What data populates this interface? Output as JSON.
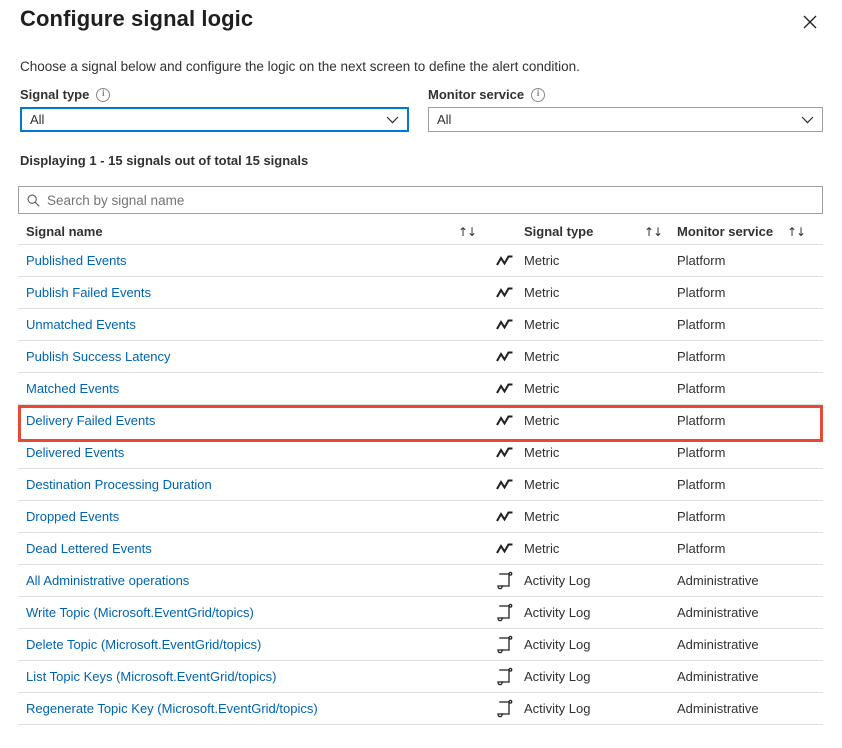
{
  "header": {
    "title": "Configure signal logic",
    "close_icon": "close-icon"
  },
  "description": "Choose a signal below and configure the logic on the next screen to define the alert condition.",
  "filters": {
    "signal_type": {
      "label": "Signal type",
      "info_icon": "info-icon",
      "value": "All",
      "chevron_icon": "chevron-down-icon",
      "focused": true
    },
    "monitor_service": {
      "label": "Monitor service",
      "info_icon": "info-icon",
      "value": "All",
      "chevron_icon": "chevron-down-icon",
      "focused": false
    }
  },
  "displaying": "Displaying 1 - 15 signals out of total 15 signals",
  "search": {
    "placeholder": "Search by signal name",
    "value": "",
    "icon": "search-icon"
  },
  "table": {
    "columns": [
      {
        "label": "Signal name",
        "sort_icon": "sort-ascending-descending-icon"
      },
      {
        "label": "Signal type",
        "sort_icon": "sort-ascending-descending-icon"
      },
      {
        "label": "Monitor service",
        "sort_icon": "sort-ascending-descending-icon"
      }
    ],
    "sort_glyph": "↑↓",
    "rows": [
      {
        "name": "Published Events",
        "type": "Metric",
        "type_icon": "metric-line-chart-icon",
        "service": "Platform",
        "highlighted": false
      },
      {
        "name": "Publish Failed Events",
        "type": "Metric",
        "type_icon": "metric-line-chart-icon",
        "service": "Platform",
        "highlighted": false
      },
      {
        "name": "Unmatched Events",
        "type": "Metric",
        "type_icon": "metric-line-chart-icon",
        "service": "Platform",
        "highlighted": false
      },
      {
        "name": "Publish Success Latency",
        "type": "Metric",
        "type_icon": "metric-line-chart-icon",
        "service": "Platform",
        "highlighted": false
      },
      {
        "name": "Matched Events",
        "type": "Metric",
        "type_icon": "metric-line-chart-icon",
        "service": "Platform",
        "highlighted": false
      },
      {
        "name": "Delivery Failed Events",
        "type": "Metric",
        "type_icon": "metric-line-chart-icon",
        "service": "Platform",
        "highlighted": true
      },
      {
        "name": "Delivered Events",
        "type": "Metric",
        "type_icon": "metric-line-chart-icon",
        "service": "Platform",
        "highlighted": false
      },
      {
        "name": "Destination Processing Duration",
        "type": "Metric",
        "type_icon": "metric-line-chart-icon",
        "service": "Platform",
        "highlighted": false
      },
      {
        "name": "Dropped Events",
        "type": "Metric",
        "type_icon": "metric-line-chart-icon",
        "service": "Platform",
        "highlighted": false
      },
      {
        "name": "Dead Lettered Events",
        "type": "Metric",
        "type_icon": "metric-line-chart-icon",
        "service": "Platform",
        "highlighted": false
      },
      {
        "name": "All Administrative operations",
        "type": "Activity Log",
        "type_icon": "activity-log-scroll-icon",
        "service": "Administrative",
        "highlighted": false
      },
      {
        "name": "Write Topic (Microsoft.EventGrid/topics)",
        "type": "Activity Log",
        "type_icon": "activity-log-scroll-icon",
        "service": "Administrative",
        "highlighted": false
      },
      {
        "name": "Delete Topic (Microsoft.EventGrid/topics)",
        "type": "Activity Log",
        "type_icon": "activity-log-scroll-icon",
        "service": "Administrative",
        "highlighted": false
      },
      {
        "name": "List Topic Keys (Microsoft.EventGrid/topics)",
        "type": "Activity Log",
        "type_icon": "activity-log-scroll-icon",
        "service": "Administrative",
        "highlighted": false
      },
      {
        "name": "Regenerate Topic Key (Microsoft.EventGrid/topics)",
        "type": "Activity Log",
        "type_icon": "activity-log-scroll-icon",
        "service": "Administrative",
        "highlighted": false
      }
    ]
  },
  "colors": {
    "link": "#0063b1",
    "accent": "#0078d4",
    "highlight_border": "#e64a36",
    "divider": "#e1dfdd",
    "text": "#323130"
  }
}
